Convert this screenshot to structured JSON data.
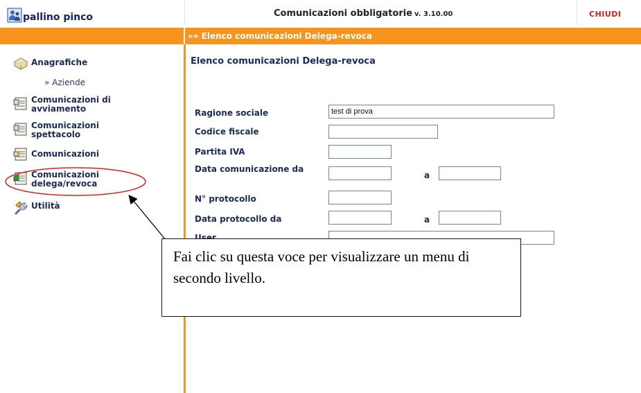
{
  "header": {
    "user_name": "pallino pinco",
    "app_title": "Comunicazioni obbligatorie",
    "version": "v. 3.10.00",
    "close_label": "CHIUDI"
  },
  "breadcrumb": "»» Elenco comunicazioni Delega-revoca",
  "sidebar": {
    "items": [
      {
        "label": "Anagrafiche",
        "icon": "address-book-icon"
      },
      {
        "label": "Comunicazioni di avviamento",
        "icon": "document-icon"
      },
      {
        "label": "Comunicazioni spettacolo",
        "icon": "document-icon"
      },
      {
        "label": "Comunicazioni",
        "icon": "document-icon"
      },
      {
        "label": "Comunicazioni delega/revoca",
        "icon": "document-green-icon"
      },
      {
        "label": "Utilità",
        "icon": "tools-icon"
      }
    ],
    "sub_items": [
      {
        "label": "» Aziende"
      }
    ]
  },
  "main": {
    "title": "Elenco comunicazioni Delega-revoca",
    "fields": {
      "ragione_sociale": {
        "label": "Ragione sociale",
        "value": "test di prova"
      },
      "codice_fiscale": {
        "label": "Codice fiscale",
        "value": ""
      },
      "partita_iva": {
        "label": "Partita IVA",
        "value": ""
      },
      "data_comunicazione": {
        "label": "Data comunicazione da",
        "value_from": "",
        "to_label": "a",
        "value_to": ""
      },
      "protocollo": {
        "label": "N° protocollo",
        "value": ""
      },
      "data_protocollo": {
        "label": "Data protocollo da",
        "value_from": "",
        "to_label": "a",
        "value_to": ""
      },
      "user": {
        "label": "User",
        "value": ""
      }
    }
  },
  "annotation": {
    "text": "Fai clic su questa voce  per visualizzare un menu di secondo livello."
  },
  "colors": {
    "accent": "#f7941d",
    "nav_text": "#1b2a5b",
    "close": "#d0211b",
    "highlight_ring": "#e02020"
  }
}
